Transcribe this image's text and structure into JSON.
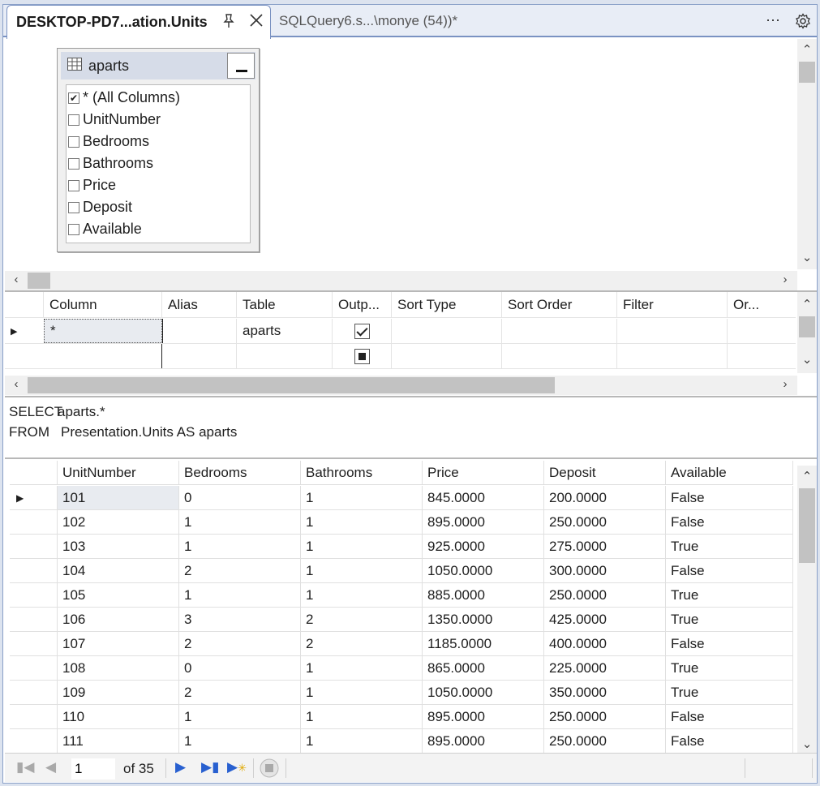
{
  "tabs": [
    {
      "label": "DESKTOP-PD7...ation.Units",
      "active": true
    },
    {
      "label": "SQLQuery6.s...\\monye (54))*",
      "active": false
    }
  ],
  "diagram": {
    "table_name": "aparts",
    "columns": [
      {
        "label": "* (All Columns)",
        "checked": true
      },
      {
        "label": "UnitNumber",
        "checked": false
      },
      {
        "label": "Bedrooms",
        "checked": false
      },
      {
        "label": "Bathrooms",
        "checked": false
      },
      {
        "label": "Price",
        "checked": false
      },
      {
        "label": "Deposit",
        "checked": false
      },
      {
        "label": "Available",
        "checked": false
      }
    ]
  },
  "criteria": {
    "headers": [
      "Column",
      "Alias",
      "Table",
      "Outp...",
      "Sort Type",
      "Sort Order",
      "Filter",
      "Or..."
    ],
    "rows": [
      {
        "column": "*",
        "alias": "",
        "table": "aparts",
        "output": "checked"
      },
      {
        "column": "",
        "alias": "",
        "table": "",
        "output": "indeterminate"
      }
    ]
  },
  "sql": {
    "line1_kw": "SELECT",
    "line1_rest": "aparts.*",
    "line2_kw": "FROM",
    "line2_rest": "Presentation.Units AS aparts"
  },
  "results": {
    "headers": [
      "UnitNumber",
      "Bedrooms",
      "Bathrooms",
      "Price",
      "Deposit",
      "Available"
    ],
    "rows": [
      [
        "101",
        "0",
        "1",
        "845.0000",
        "200.0000",
        "False"
      ],
      [
        "102",
        "1",
        "1",
        "895.0000",
        "250.0000",
        "False"
      ],
      [
        "103",
        "1",
        "1",
        "925.0000",
        "275.0000",
        "True"
      ],
      [
        "104",
        "2",
        "1",
        "1050.0000",
        "300.0000",
        "False"
      ],
      [
        "105",
        "1",
        "1",
        "885.0000",
        "250.0000",
        "True"
      ],
      [
        "106",
        "3",
        "2",
        "1350.0000",
        "425.0000",
        "True"
      ],
      [
        "107",
        "2",
        "2",
        "1185.0000",
        "400.0000",
        "False"
      ],
      [
        "108",
        "0",
        "1",
        "865.0000",
        "225.0000",
        "True"
      ],
      [
        "109",
        "2",
        "1",
        "1050.0000",
        "350.0000",
        "True"
      ],
      [
        "110",
        "1",
        "1",
        "895.0000",
        "250.0000",
        "False"
      ],
      [
        "111",
        "1",
        "1",
        "895.0000",
        "250.0000",
        "False"
      ]
    ]
  },
  "navigation": {
    "current_page": "1",
    "of_label": "of 35"
  },
  "icons": {
    "pin": "pin-icon",
    "close": "close-icon",
    "more": "more-icon",
    "settings": "gear-icon"
  },
  "colors": {
    "tab_border": "#7a92c2",
    "nav_accent": "#2860d0",
    "table_header": "#d6dce8"
  }
}
